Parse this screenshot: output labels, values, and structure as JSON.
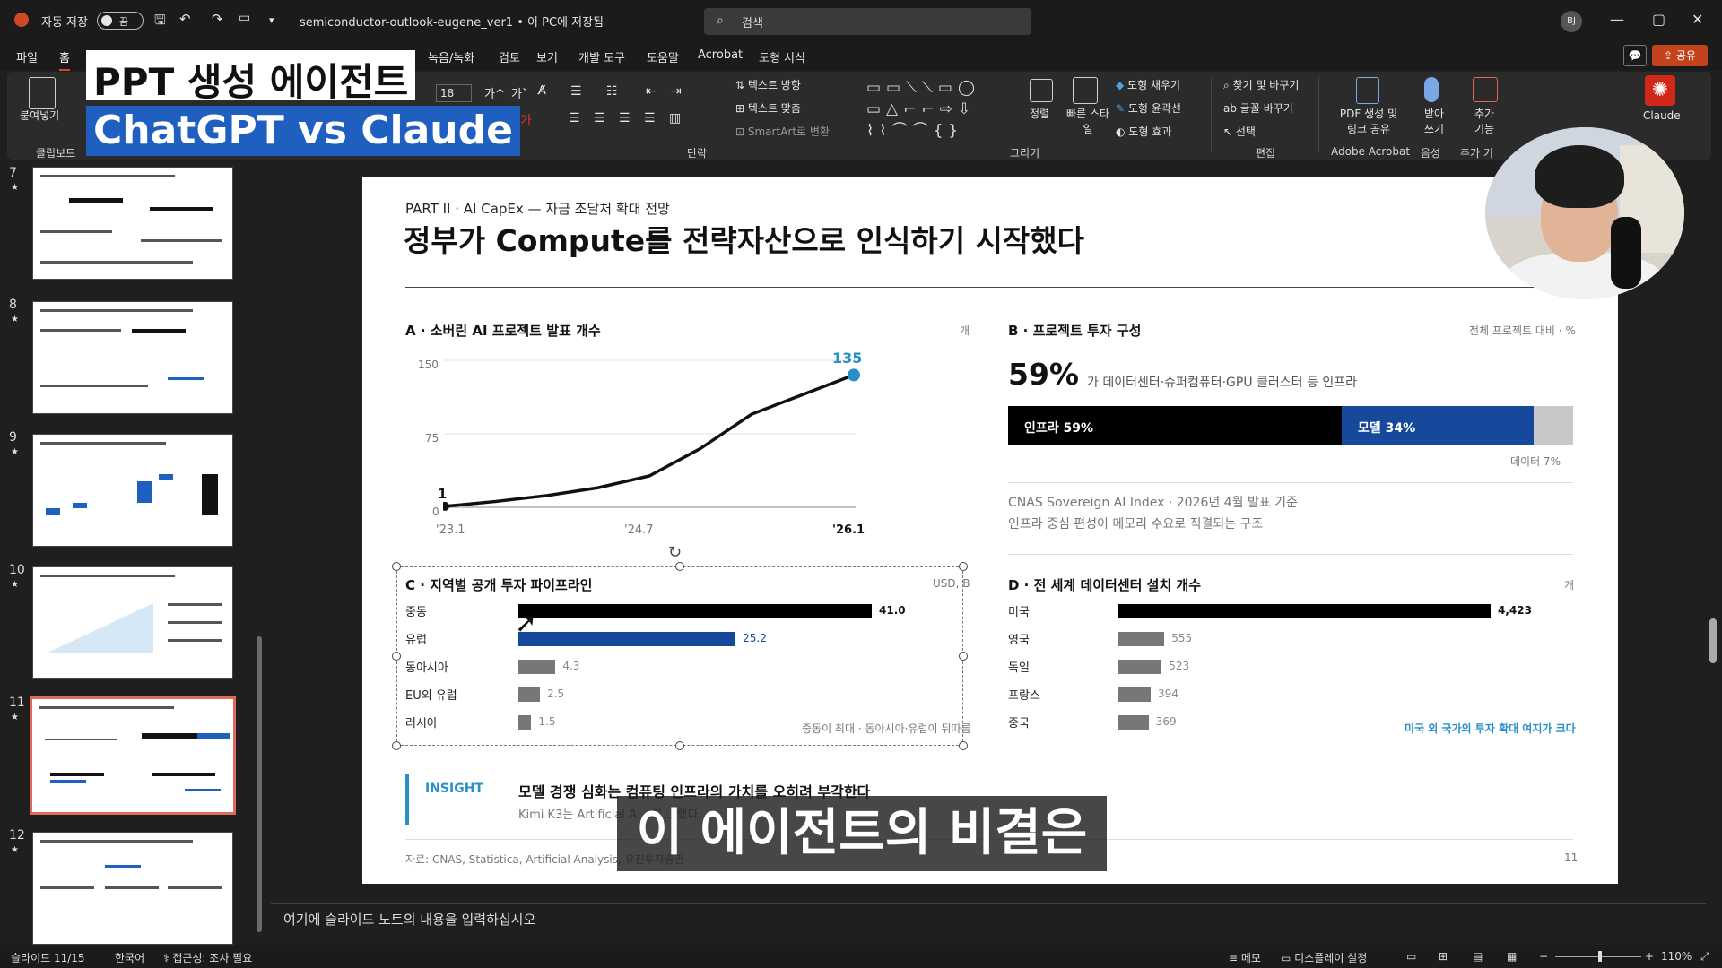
{
  "titlebar": {
    "autosave_label": "자동 저장",
    "autosave_state": "끔",
    "filename": "semiconductor-outlook-eugene_ver1 • 이 PC에 저장됨",
    "search_placeholder": "검색",
    "user_initials": "BJ"
  },
  "menu": {
    "items": [
      "파일",
      "홈",
      "녹음/녹화",
      "검토",
      "보기",
      "개발 도구",
      "도움말",
      "Acrobat",
      "도형 서식"
    ],
    "share_label": "공유"
  },
  "overlay": {
    "line1": "PPT 생성 에이전트",
    "line2": "ChatGPT vs Claude"
  },
  "ribbon": {
    "paste": "붙여넣기",
    "clipboard": "클립보드",
    "paragraph": "단락",
    "drawing": "그리기",
    "editing": "편집",
    "adobe": "Adobe Acrobat",
    "voice": "음성",
    "addin": "추가 기",
    "font_size": "18",
    "text_direction": "텍스트 방향",
    "text_align": "텍스트 맞춤",
    "smartart": "SmartArt로 변환",
    "arrange": "정렬",
    "quick_styles": "빠른 스타일",
    "shape_fill": "도형 채우기",
    "shape_outline": "도형 윤곽선",
    "shape_effects": "도형 효과",
    "find_replace": "찾기 및 바꾸기",
    "replace_font": "글꼴 바꾸기",
    "select": "선택",
    "pdf_share": "PDF 생성 및 링크 공유",
    "dictate": "받아 쓰기",
    "addins": "추가 기능",
    "claude": "Claude"
  },
  "thumbnails": [
    {
      "num": "7"
    },
    {
      "num": "8"
    },
    {
      "num": "9"
    },
    {
      "num": "10"
    },
    {
      "num": "11"
    },
    {
      "num": "12"
    }
  ],
  "slide": {
    "part": "PART II · AI CapEx — 자금 조달처 확대 전망",
    "title": "정부가 Compute를 전략자산으로 인식하기 시작했다",
    "a": {
      "title": "A · 소버린 AI 프로젝트 발표 개수",
      "unit": "개",
      "y_ticks": [
        "150",
        "75",
        "0"
      ],
      "x_start": "'23.1",
      "x_mid": "'24.7",
      "x_end": "'26.1",
      "start_label": "1",
      "end_label": "135"
    },
    "b": {
      "title": "B · 프로젝트 투자 구성",
      "unit": "전체 프로젝트 대비 · %",
      "big_value": "59%",
      "big_desc": "가 데이터센터·슈퍼컴퓨터·GPU 클러스터 등 인프라",
      "seg1": "인프라 59%",
      "seg2": "모델 34%",
      "seg3": "데이터 7%",
      "note1": "CNAS Sovereign AI Index · 2026년 4월 발표 기준",
      "note2": "인프라 중심 편성이 메모리 수요로 직결되는 구조"
    },
    "c": {
      "title": "C · 지역별 공개 투자 파이프라인",
      "unit": "USD, B",
      "footnote": "중동이 최대 · 동아시아·유럽이 뒤따름"
    },
    "d": {
      "title": "D · 전 세계 데이터센터 설치 개수",
      "unit": "개",
      "footnote": "미국 외 국가의 투자 확대 여지가 크다"
    },
    "insight": {
      "label": "INSIGHT",
      "headline": "모델 경쟁 심화는 컴퓨팅 인프라의 가치를 오히려 부각한다",
      "body": "Kimi K3는 Artificial A... 지... 했다"
    },
    "source": "자료: CNAS, Statistica, Artificial Analysis, 유진투자증권",
    "page_num": "11"
  },
  "chart_data": [
    {
      "type": "line",
      "title": "A · 소버린 AI 프로젝트 발표 개수",
      "ylabel": "개",
      "x": [
        "'23.1",
        "",
        "",
        "",
        "'24.7",
        "",
        "",
        "",
        "'26.1"
      ],
      "values": [
        1,
        6,
        12,
        20,
        32,
        60,
        95,
        115,
        135
      ],
      "ylim": [
        0,
        150
      ],
      "yticks": [
        0,
        75,
        150
      ],
      "grid": true
    },
    {
      "type": "bar",
      "title": "B · 프로젝트 투자 구성",
      "categories": [
        "인프라",
        "모델",
        "데이터"
      ],
      "values": [
        59,
        34,
        7
      ],
      "ylabel": "%"
    },
    {
      "type": "bar",
      "title": "C · 지역별 공개 투자 파이프라인",
      "categories": [
        "중동",
        "유럽",
        "동아시아",
        "EU외 유럽",
        "러시아"
      ],
      "values": [
        41.0,
        25.2,
        4.3,
        2.5,
        1.5
      ],
      "labels": [
        "41.0",
        "25.2",
        "4.3",
        "2.5",
        "1.5"
      ],
      "ylabel": "USD, B"
    },
    {
      "type": "bar",
      "title": "D · 전 세계 데이터센터 설치 개수",
      "categories": [
        "미국",
        "영국",
        "독일",
        "프랑스",
        "중국"
      ],
      "values": [
        4423,
        555,
        523,
        394,
        369
      ],
      "labels": [
        "4,423",
        "555",
        "523",
        "394",
        "369"
      ],
      "ylabel": "개"
    }
  ],
  "notes": {
    "placeholder": "여기에 슬라이드 노트의 내용을 입력하십시오"
  },
  "status": {
    "slide": "슬라이드 11/15",
    "lang": "한국어",
    "accessibility": "접근성: 조사 필요",
    "notes_btn": "메모",
    "display": "디스플레이 설정",
    "zoom": "110%"
  },
  "subtitle": "이 에이전트의 비결은"
}
